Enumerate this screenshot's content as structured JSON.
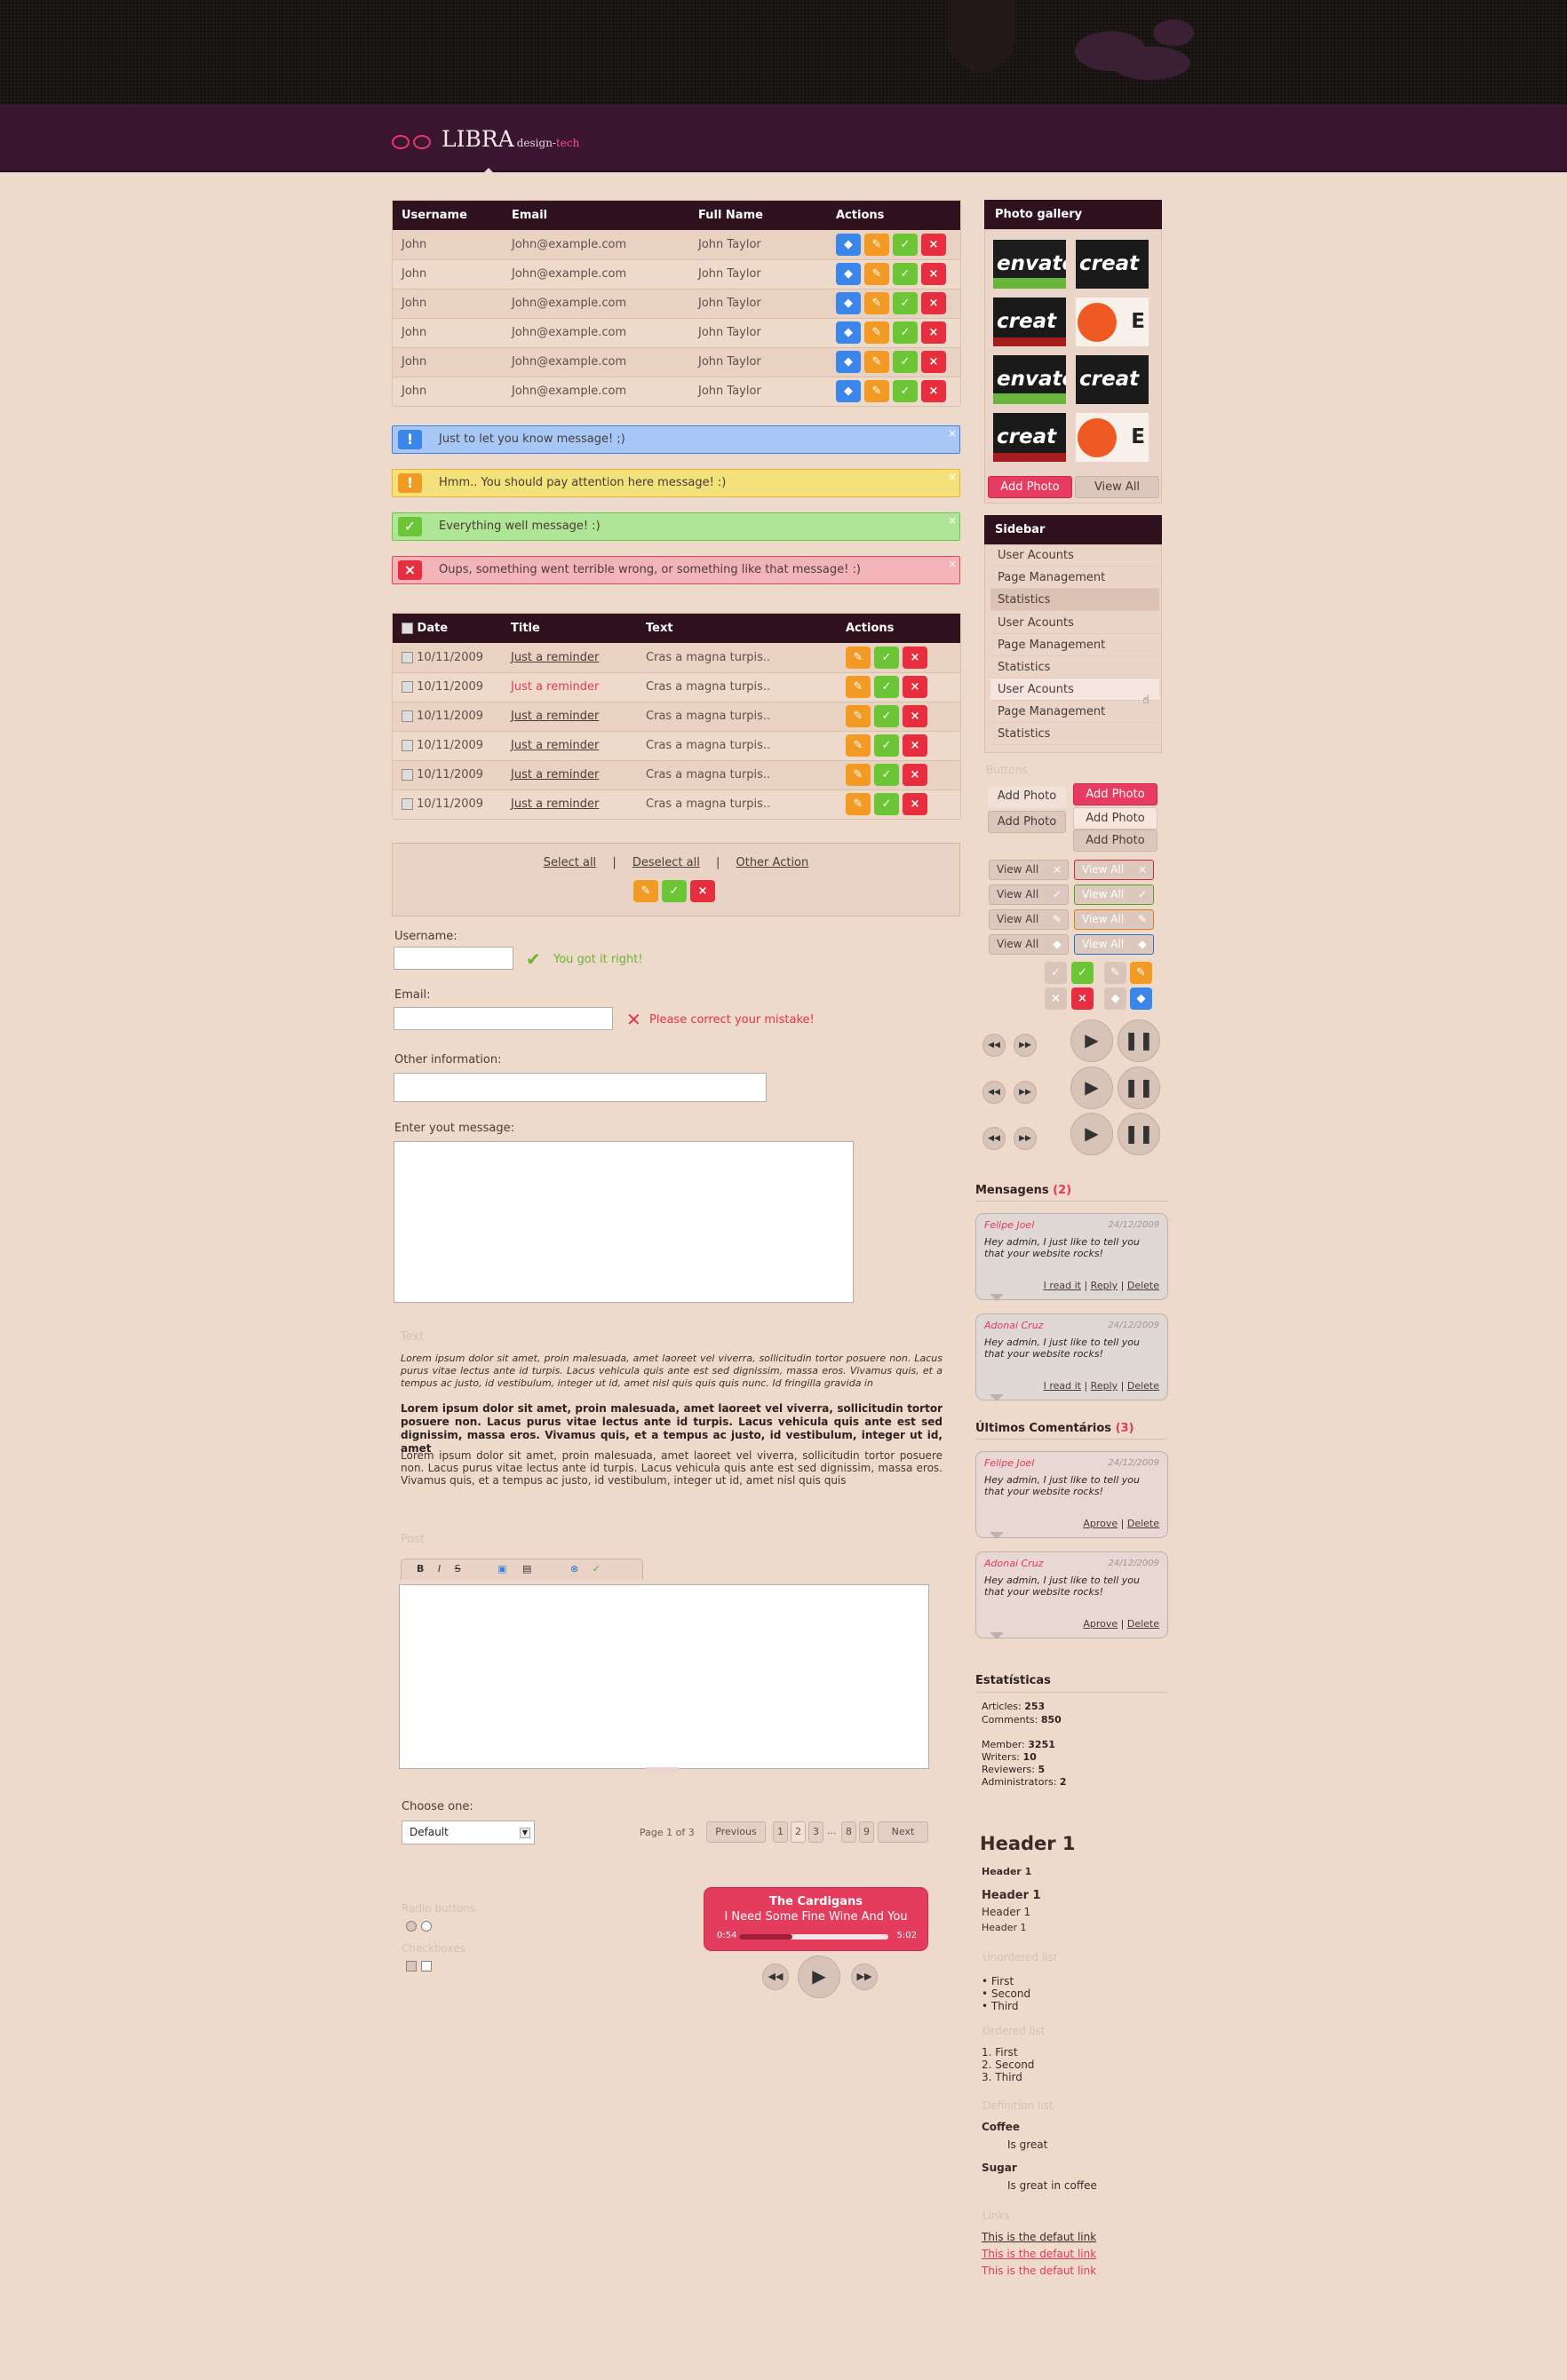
{
  "brand": {
    "name": "LIBRA",
    "design": "design-",
    "tech": "tech"
  },
  "users_table": {
    "headers": [
      "Username",
      "Email",
      "Full Name",
      "Actions"
    ],
    "rows": [
      [
        "John",
        "John@example.com",
        "John Taylor"
      ],
      [
        "John",
        "John@example.com",
        "John Taylor"
      ],
      [
        "John",
        "John@example.com",
        "John Taylor"
      ],
      [
        "John",
        "John@example.com",
        "John Taylor"
      ],
      [
        "John",
        "John@example.com",
        "John Taylor"
      ],
      [
        "John",
        "John@example.com",
        "John Taylor"
      ]
    ]
  },
  "messages": [
    {
      "icon": "!",
      "text": "Just to let you know message! ;)"
    },
    {
      "icon": "!",
      "text": "Hmm.. You should pay attention here message! :)"
    },
    {
      "icon": "✓",
      "text": "Everything well message! :)"
    },
    {
      "icon": "×",
      "text": "Oups, something went terrible wrong, or something like that message! :)"
    }
  ],
  "reminders_table": {
    "headers": [
      "Date",
      "Title",
      "Text",
      "Actions"
    ],
    "rows": [
      {
        "date": "10/11/2009",
        "title": "Just a reminder",
        "text": "Cras a magna turpis.."
      },
      {
        "date": "10/11/2009",
        "title": "Just a reminder",
        "text": "Cras a magna turpis.."
      },
      {
        "date": "10/11/2009",
        "title": "Just a reminder",
        "text": "Cras a magna turpis.."
      },
      {
        "date": "10/11/2009",
        "title": "Just a reminder",
        "text": "Cras a magna turpis.."
      },
      {
        "date": "10/11/2009",
        "title": "Just a reminder",
        "text": "Cras a magna turpis.."
      },
      {
        "date": "10/11/2009",
        "title": "Just a reminder",
        "text": "Cras a magna turpis.."
      }
    ]
  },
  "select_actions": {
    "select_all": "Select all",
    "sep1": "|",
    "deselect_all": "Deselect all",
    "sep2": "|",
    "other": "Other Action"
  },
  "form": {
    "username_label": "Username:",
    "username_ok": "You got it right!",
    "email_label": "Email:",
    "email_error": "Please correct your mistake!",
    "other_label": "Other information:",
    "message_label": "Enter yout message:"
  },
  "text_section": {
    "heading": "Text",
    "p1": "Lorem ipsum dolor sit amet, proin malesuada, amet laoreet vel viverra, sollicitudin tortor posuere non. Lacus purus vitae lectus ante id turpis. Lacus vehicula quis ante est sed dignissim, massa eros. Vivamus quis, et a tempus ac justo, id vestibulum, integer ut id, amet nisl quis quis quis nunc. Id fringilla gravida in",
    "p2": "Lorem ipsum dolor sit amet, proin malesuada, amet laoreet vel viverra, sollicitudin tortor posuere non. Lacus purus vitae lectus ante id turpis. Lacus vehicula quis ante est sed dignissim, massa eros. Vivamus quis, et a tempus ac justo, id vestibulum, integer ut id, amet",
    "p3": "Lorem ipsum dolor sit amet, proin malesuada, amet laoreet vel viverra, sollicitudin tortor posuere non. Lacus purus vitae lectus ante id turpis. Lacus vehicula quis ante est sed dignissim, massa eros. Vivamus quis, et a tempus ac justo, id vestibulum, integer ut id, amet nisl quis quis"
  },
  "post_label": "Post",
  "choose": {
    "label": "Choose one:",
    "value": "Default"
  },
  "pagination": {
    "info": "Page 1 of 3",
    "previous": "Previous",
    "pages": [
      "1",
      "2",
      "3",
      "...",
      "8",
      "9"
    ],
    "next": "Next"
  },
  "radio_label": "Radio buttons",
  "checkbox_label": "Checkboxes",
  "player": {
    "artist": "The Cardigans",
    "song": "I Need Some Fine Wine And You",
    "elapsed": "0:54",
    "total": "5:02",
    "progress": 0.36
  },
  "gallery": {
    "title": "Photo gallery",
    "add": "Add Photo",
    "view_all": "View All",
    "thumbs": [
      "envato",
      "creat",
      "creat",
      "E",
      "envato",
      "creat",
      "creat",
      "E"
    ]
  },
  "sidebar": {
    "title": "Sidebar",
    "items": [
      "User Acounts",
      "Page Management",
      "Statistics",
      "User Acounts",
      "Page Management",
      "Statistics",
      "User Acounts",
      "Page Management",
      "Statistics"
    ]
  },
  "buttons": {
    "heading": "Buttons",
    "add_photo": "Add Photo",
    "view_all": "View All"
  },
  "mensagens": {
    "heading": "Mensagens",
    "count": "(2)",
    "comments": [
      {
        "name": "Felipe Joel",
        "date": "24/12/2009",
        "text": "Hey admin, I just like to tell you that your website rocks!",
        "actions": [
          "I read it",
          "Reply",
          "Delete"
        ]
      },
      {
        "name": "Adonai Cruz",
        "date": "24/12/2009",
        "text": "Hey admin, I just like to tell you that your website rocks!",
        "actions": [
          "I read it",
          "Reply",
          "Delete"
        ]
      }
    ]
  },
  "comentarios": {
    "heading": "Últimos Comentários",
    "count": "(3)",
    "comments": [
      {
        "name": "Felipe Joel",
        "date": "24/12/2009",
        "text": "Hey admin, I just like to tell you that your website rocks!",
        "actions": [
          "Aprove",
          "Delete"
        ]
      },
      {
        "name": "Adonai Cruz",
        "date": "24/12/2009",
        "text": "Hey admin, I just like to tell you that your website rocks!",
        "actions": [
          "Aprove",
          "Delete"
        ]
      }
    ]
  },
  "estatisticas": {
    "heading": "Estatísticas",
    "articles": "253",
    "comments": "850",
    "member": "3251",
    "writers": "10",
    "reviewers": "5",
    "administrators": "2"
  },
  "typography": {
    "h1": "Header 1",
    "h2": "Header 1",
    "h3": "Header 1",
    "h4": "Header 1",
    "h5": "Header 1",
    "unordered": "Unordered list",
    "ul": [
      "• First",
      "• Second",
      "• Third"
    ],
    "ordered": "Ordered list",
    "ol": [
      "1. First",
      "2. Second",
      "3. Third"
    ],
    "definition": "Definition list",
    "dl": [
      {
        "term": "Coffee",
        "desc": "Is great"
      },
      {
        "term": "Sugar",
        "desc": "Is great in coffee"
      }
    ],
    "links": "Links",
    "link1": "This is the defaut link",
    "link2": "This is the defaut link",
    "link3": "This is the defaut link"
  }
}
